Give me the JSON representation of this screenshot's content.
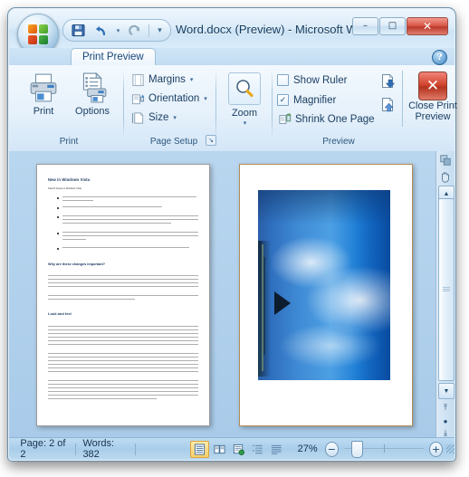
{
  "window": {
    "title": "Word.docx (Preview)  -  Microsoft W...",
    "office_button": "office-orb",
    "controls": {
      "minimize": "–",
      "maximize": "□",
      "close": "✕"
    }
  },
  "quick_access": {
    "items": [
      {
        "name": "save-button",
        "icon": "save-icon",
        "label": "Save"
      },
      {
        "name": "undo-button",
        "icon": "undo-icon",
        "label": "Undo"
      },
      {
        "name": "redo-button",
        "icon": "redo-icon",
        "label": "Redo"
      },
      {
        "name": "customize-qat-button",
        "icon": "chevron-down-icon",
        "label": "Customize Quick Access Toolbar"
      }
    ]
  },
  "tabs": [
    {
      "label": "Print Preview",
      "selected": true
    }
  ],
  "help": {
    "label": "?"
  },
  "ribbon": {
    "groups": [
      {
        "label": "Print",
        "buttons": [
          {
            "label": "Print",
            "icon": "printer-icon"
          },
          {
            "label": "Options",
            "icon": "print-options-icon"
          }
        ]
      },
      {
        "label": "Page Setup",
        "has_dialog_launcher": true,
        "dialog_launcher_glyph": "↘",
        "buttons": [
          {
            "label": "Margins",
            "icon": "margins-icon",
            "caret": "▾"
          },
          {
            "label": "Orientation",
            "icon": "orientation-icon",
            "caret": "▾"
          },
          {
            "label": "Size",
            "icon": "page-size-icon",
            "caret": "▾"
          }
        ]
      },
      {
        "label": "",
        "buttons": [
          {
            "label": "Zoom",
            "icon": "magnifier-icon",
            "caret": "▾"
          }
        ]
      },
      {
        "label": "Preview",
        "checkboxes": [
          {
            "label": "Show Ruler",
            "checked": false,
            "icon": "ruler-checkbox"
          },
          {
            "label": "Magnifier",
            "checked": true,
            "icon": "magnifier-checkbox"
          }
        ],
        "buttons": [
          {
            "label": "Shrink One Page",
            "icon": "shrink-one-page-icon"
          },
          {
            "label": "Next Page",
            "icon": "next-page-icon"
          },
          {
            "label": "Previous Page",
            "icon": "previous-page-icon"
          }
        ],
        "close_button": {
          "line1": "Close Print",
          "line2": "Preview",
          "icon": "close-red-x-icon"
        }
      }
    ]
  },
  "document": {
    "page_left": {
      "heading1": "New in Windows Vista",
      "intro": "Search Issues in Windows Vista",
      "bullets": [
        "Go beyond in the upper-right corner of all Windows Explorer windows, so they are easy to find and easy to use.",
        "Find a word or column appears across all of each color.",
        "Show result is based on where users expect to find them most. For example, Search in the Start menu searches for programs, recently visited files, and Web sites, whereas Search in the Control Panel home page searches for Control Panel functionality.",
        "Support in every part of where they are typing, where a search is performed and the results are displayed immediately as they type.",
        "Find advanced search features are now more accessible through a top-down menu."
      ],
      "heading2": "Why are these changes important?",
      "heading3": "Look and feel"
    },
    "page_right": {
      "image_alt": "Photograph of clouds and sky over water with a pier, rotated",
      "image_colors": {
        "sky": "#3f8ad4",
        "deep": "#0a4fa5",
        "cloud": "#ffffff"
      }
    }
  },
  "statusbar": {
    "page": "Page: 2 of 2",
    "words": "Words: 382",
    "views": [
      {
        "label": "Print Layout",
        "icon": "print-layout-icon",
        "selected": true
      },
      {
        "label": "Full Screen Reading",
        "icon": "full-screen-reading-icon",
        "selected": false
      },
      {
        "label": "Web Layout",
        "icon": "web-layout-icon",
        "selected": false
      },
      {
        "label": "Outline",
        "icon": "outline-icon",
        "selected": false
      },
      {
        "label": "Draft",
        "icon": "draft-icon",
        "selected": false
      }
    ],
    "zoom": "27%",
    "zoom_out": "−",
    "zoom_in": "+"
  },
  "scrollbar": {
    "up": "▲",
    "down": "▼",
    "prev_page": "⤒",
    "browse_object": "●",
    "next_page": "⤓",
    "pan_icon": "hand-icon",
    "select_icon": "select-object-icon"
  }
}
